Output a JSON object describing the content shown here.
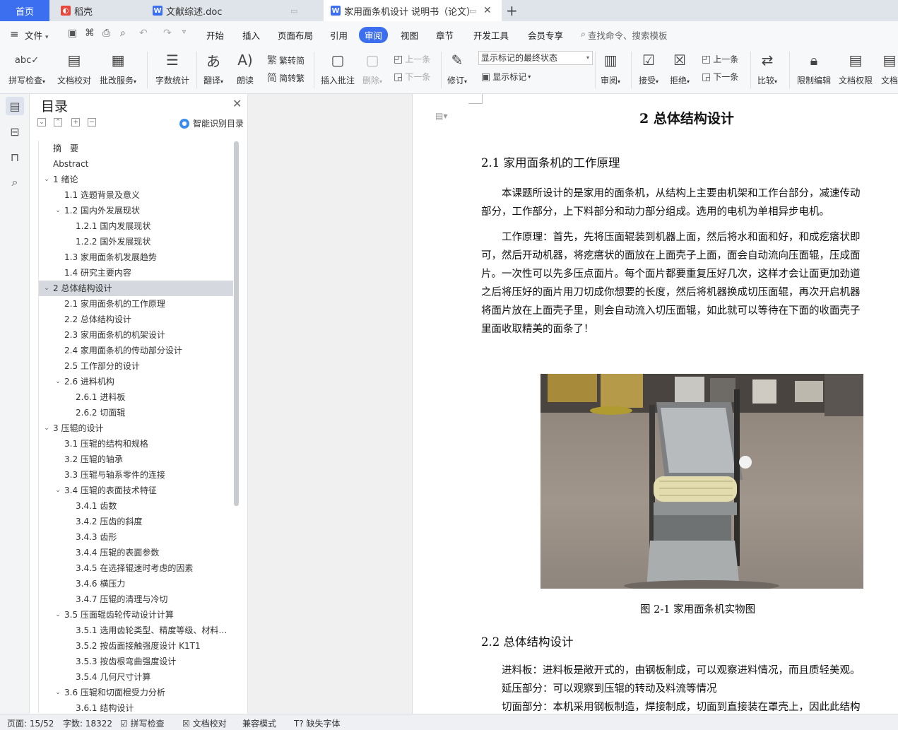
{
  "tabs": [
    {
      "label": "首页"
    },
    {
      "label": "稻壳",
      "icon": "docer-icon"
    },
    {
      "label": "文献综述.doc",
      "icon": "word-doc-icon"
    },
    {
      "label": "家用面条机设计 说明书（论文）",
      "icon": "word-doc-icon"
    }
  ],
  "menu": {
    "file": "文件",
    "items": [
      "开始",
      "插入",
      "页面布局",
      "引用",
      "审阅",
      "视图",
      "章节",
      "开发工具",
      "会员专享"
    ],
    "active": "审阅",
    "search": "查找命令、搜索模板"
  },
  "ribbon": {
    "spellcheck": "拼写检查",
    "doccheck": "文档校对",
    "correction": "批改服务",
    "wordcount": "字数统计",
    "translate": "翻译",
    "read": "朗读",
    "trad": "繁转简",
    "simp": "简转繁",
    "insert_comment": "插入批注",
    "delete": "删除",
    "prev": "上一条",
    "next": "下一条",
    "revise": "修订",
    "markup_state": "显示标记的最终状态",
    "show_markup": "显示标记",
    "review": "审阅",
    "accept": "接受",
    "reject": "拒绝",
    "prev2": "上一条",
    "next2": "下一条",
    "compare": "比较",
    "restrict": "限制编辑",
    "permission": "文档权限",
    "doc_more": "文档"
  },
  "toc": {
    "title": "目录",
    "smart": "智能识别目录",
    "items": [
      {
        "t": "摘　要",
        "lvl": 0,
        "exp": ""
      },
      {
        "t": "Abstract",
        "lvl": 0,
        "exp": ""
      },
      {
        "t": "1 绪论",
        "lvl": 0,
        "exp": "open"
      },
      {
        "t": "1.1 选题背景及意义",
        "lvl": 1,
        "exp": ""
      },
      {
        "t": "1.2 国内外发展现状",
        "lvl": 1,
        "exp": "open"
      },
      {
        "t": "1.2.1 国内发展现状",
        "lvl": 2,
        "exp": ""
      },
      {
        "t": "1.2.2 国外发展现状",
        "lvl": 2,
        "exp": ""
      },
      {
        "t": "1.3 家用面条机发展趋势",
        "lvl": 1,
        "exp": ""
      },
      {
        "t": "1.4 研究主要内容",
        "lvl": 1,
        "exp": ""
      },
      {
        "t": "2  总体结构设计",
        "lvl": 0,
        "exp": "open",
        "sel": true
      },
      {
        "t": "2.1 家用面条机的工作原理",
        "lvl": 1,
        "exp": ""
      },
      {
        "t": "2.2 总体结构设计",
        "lvl": 1,
        "exp": ""
      },
      {
        "t": "2.3 家用面条机的机架设计",
        "lvl": 1,
        "exp": ""
      },
      {
        "t": "2.4 家用面条机的传动部分设计",
        "lvl": 1,
        "exp": ""
      },
      {
        "t": "2.5 工作部分的设计",
        "lvl": 1,
        "exp": ""
      },
      {
        "t": "2.6 进料机构",
        "lvl": 1,
        "exp": "open"
      },
      {
        "t": "2.6.1 进料板",
        "lvl": 2,
        "exp": ""
      },
      {
        "t": "2.6.2 切面辊",
        "lvl": 2,
        "exp": ""
      },
      {
        "t": "3  压辊的设计",
        "lvl": 0,
        "exp": "open"
      },
      {
        "t": "3.1 压辊的结构和规格",
        "lvl": 1,
        "exp": ""
      },
      {
        "t": "3.2 压辊的轴承",
        "lvl": 1,
        "exp": ""
      },
      {
        "t": "3.3 压辊与轴系零件的连接",
        "lvl": 1,
        "exp": ""
      },
      {
        "t": "3.4 压辊的表面技术特征",
        "lvl": 1,
        "exp": "open"
      },
      {
        "t": "3.4.1 齿数",
        "lvl": 2,
        "exp": ""
      },
      {
        "t": "3.4.2 压齿的斜度",
        "lvl": 2,
        "exp": ""
      },
      {
        "t": "3.4.3 齿形",
        "lvl": 2,
        "exp": ""
      },
      {
        "t": "3.4.4 压辊的表面参数",
        "lvl": 2,
        "exp": ""
      },
      {
        "t": "3.4.5 在选择辊速时考虑的因素",
        "lvl": 2,
        "exp": ""
      },
      {
        "t": "3.4.6 横压力",
        "lvl": 2,
        "exp": ""
      },
      {
        "t": "3.4.7 压辊的清理与冷切",
        "lvl": 2,
        "exp": ""
      },
      {
        "t": "3.5 压面辊齿轮传动设计计算",
        "lvl": 1,
        "exp": "open"
      },
      {
        "t": "3.5.1 选用齿轮类型、精度等级、材料…",
        "lvl": 2,
        "exp": ""
      },
      {
        "t": "3.5.2 按齿面接触强度设计 K1T1",
        "lvl": 2,
        "exp": ""
      },
      {
        "t": "3.5.3 按齿根弯曲强度设计",
        "lvl": 2,
        "exp": ""
      },
      {
        "t": "3.5.4 几何尺寸计算",
        "lvl": 2,
        "exp": ""
      },
      {
        "t": "3.6 压辊和切面棍受力分析",
        "lvl": 1,
        "exp": "open"
      },
      {
        "t": "3.6.1 结构设计",
        "lvl": 2,
        "exp": ""
      }
    ]
  },
  "doc": {
    "chapter": "2  总体结构设计",
    "h21": "2.1 家用面条机的工作原理",
    "p1": [
      "本课题所设计的是家用的面条机，从结构上主要由机架和工作台部分，减速传动",
      "部分，工作部分，上下料部分和动力部分组成。选用的电机为单相异步电机。"
    ],
    "p2": [
      "工作原理：首先，先将压面辊装到机器上面，然后将水和面和好，和成疙瘩状即",
      "可，然后开动机器，将疙瘩状的面放在上面壳子上面，面会自动流向压面辊，压成面",
      "片。一次性可以先多压点面片。每个面片都要重复压好几次，这样才会让面更加劲道",
      "之后将压好的面片用刀切成你想要的长度，然后将机器换成切压面辊，再次开启机器",
      "将面片放在上面壳子里，则会自动流入切压面辊，如此就可以等待在下面的收面壳子",
      "里面收取精美的面条了！"
    ],
    "caption": "图 2-1 家用面条机实物图",
    "h22": "2.2 总体结构设计",
    "p3": [
      "进料板：进料板是敞开式的，由钢板制成，可以观察进料情况，而且质轻美观。",
      "延压部分：可以观察到压辊的转动及料流等情况",
      "切面部分：本机采用钢板制造，焊接制成，切面到直接装在罩壳上，因此此结构"
    ]
  },
  "status": {
    "page": "页面: 15/52",
    "words": "字数: 18322",
    "spell": "拼写检查",
    "proof": "文档校对",
    "compat": "兼容模式",
    "missing_font": "缺失字体"
  }
}
